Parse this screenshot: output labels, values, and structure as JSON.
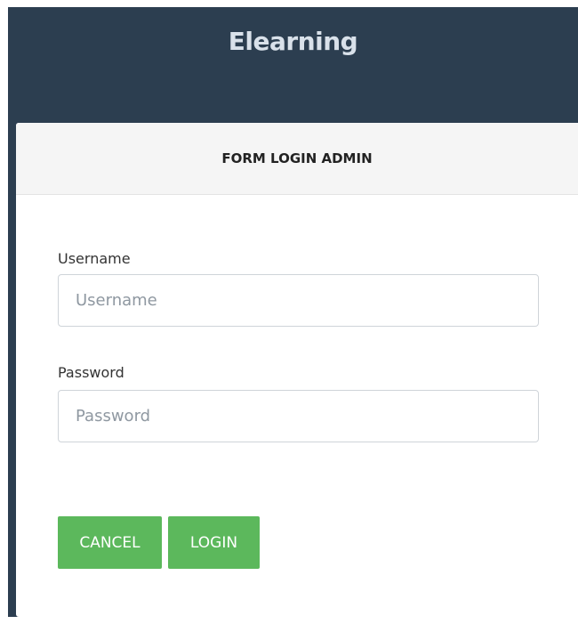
{
  "header": {
    "brand": "Elearning"
  },
  "panel": {
    "title": "FORM LOGIN ADMIN"
  },
  "form": {
    "username_label": "Username",
    "username_placeholder": "Username",
    "username_value": "",
    "password_label": "Password",
    "password_placeholder": "Password",
    "password_value": ""
  },
  "buttons": {
    "cancel": "CANCEL",
    "login": "LOGIN"
  },
  "colors": {
    "navbar": "#2c3e50",
    "brand_text": "#d9e1ea",
    "button": "#5cb85c",
    "panel_header": "#f5f5f5"
  }
}
